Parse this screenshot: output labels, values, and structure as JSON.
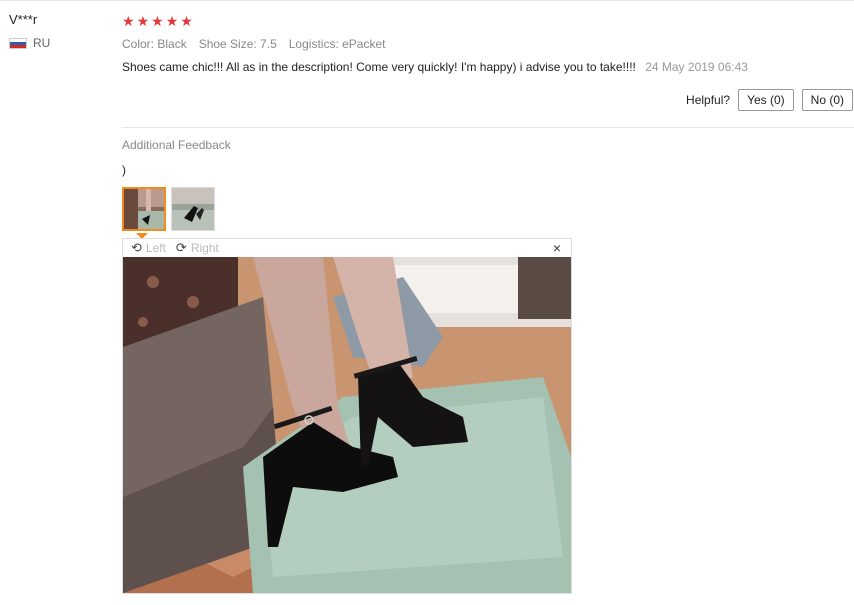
{
  "reviewer": {
    "name": "V***r",
    "country": "RU"
  },
  "rating": {
    "stars": 5
  },
  "attributes": {
    "color": "Color: Black",
    "size": "Shoe Size: 7.5",
    "logistics": "Logistics: ePacket"
  },
  "review": {
    "text": "Shoes came chic!!! All as in the description! Come very quickly! I'm happy) i advise you to take!!!!",
    "date": "24 May 2019 06:43"
  },
  "helpful": {
    "label": "Helpful?",
    "yes": "Yes (0)",
    "no": "No (0)"
  },
  "additional": {
    "label": "Additional Feedback",
    "text": ")"
  },
  "viewer": {
    "left": "Left",
    "right": "Right",
    "close": "×"
  },
  "icons": {
    "star": "star-icon",
    "rotate_left": "rotate-left-icon",
    "rotate_right": "rotate-right-icon",
    "close": "close-icon"
  },
  "colors": {
    "star": "#e4393c",
    "active_thumb": "#f08c1e"
  }
}
